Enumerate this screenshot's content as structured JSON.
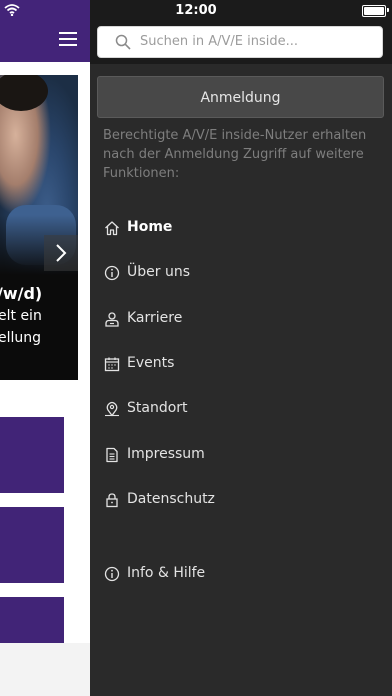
{
  "status": {
    "time": "12:00"
  },
  "hero": {
    "title": "/w/d)",
    "line1": "elt ein",
    "line2": "ellung"
  },
  "search": {
    "placeholder": "Suchen in A/V/E inside..."
  },
  "login": {
    "label": "Anmeldung",
    "note": "Berechtigte A/V/E inside-Nutzer erhalten nach der Anmeldung Zugriff auf weitere Funktionen:"
  },
  "menu": [
    {
      "label": "Home",
      "icon": "home-icon",
      "active": true
    },
    {
      "label": "Über uns",
      "icon": "info-icon"
    },
    {
      "label": "Karriere",
      "icon": "person-icon"
    },
    {
      "label": "Events",
      "icon": "calendar-icon"
    },
    {
      "label": "Standort",
      "icon": "map-pin-icon"
    },
    {
      "label": "Impressum",
      "icon": "document-icon"
    },
    {
      "label": "Datenschutz",
      "icon": "lock-icon"
    }
  ],
  "footer_menu": [
    {
      "label": "Info & Hilfe",
      "icon": "info-icon"
    }
  ],
  "colors": {
    "brand": "#432479",
    "drawer": "#2a2a2a",
    "statusbar": "#1b1b1b"
  }
}
